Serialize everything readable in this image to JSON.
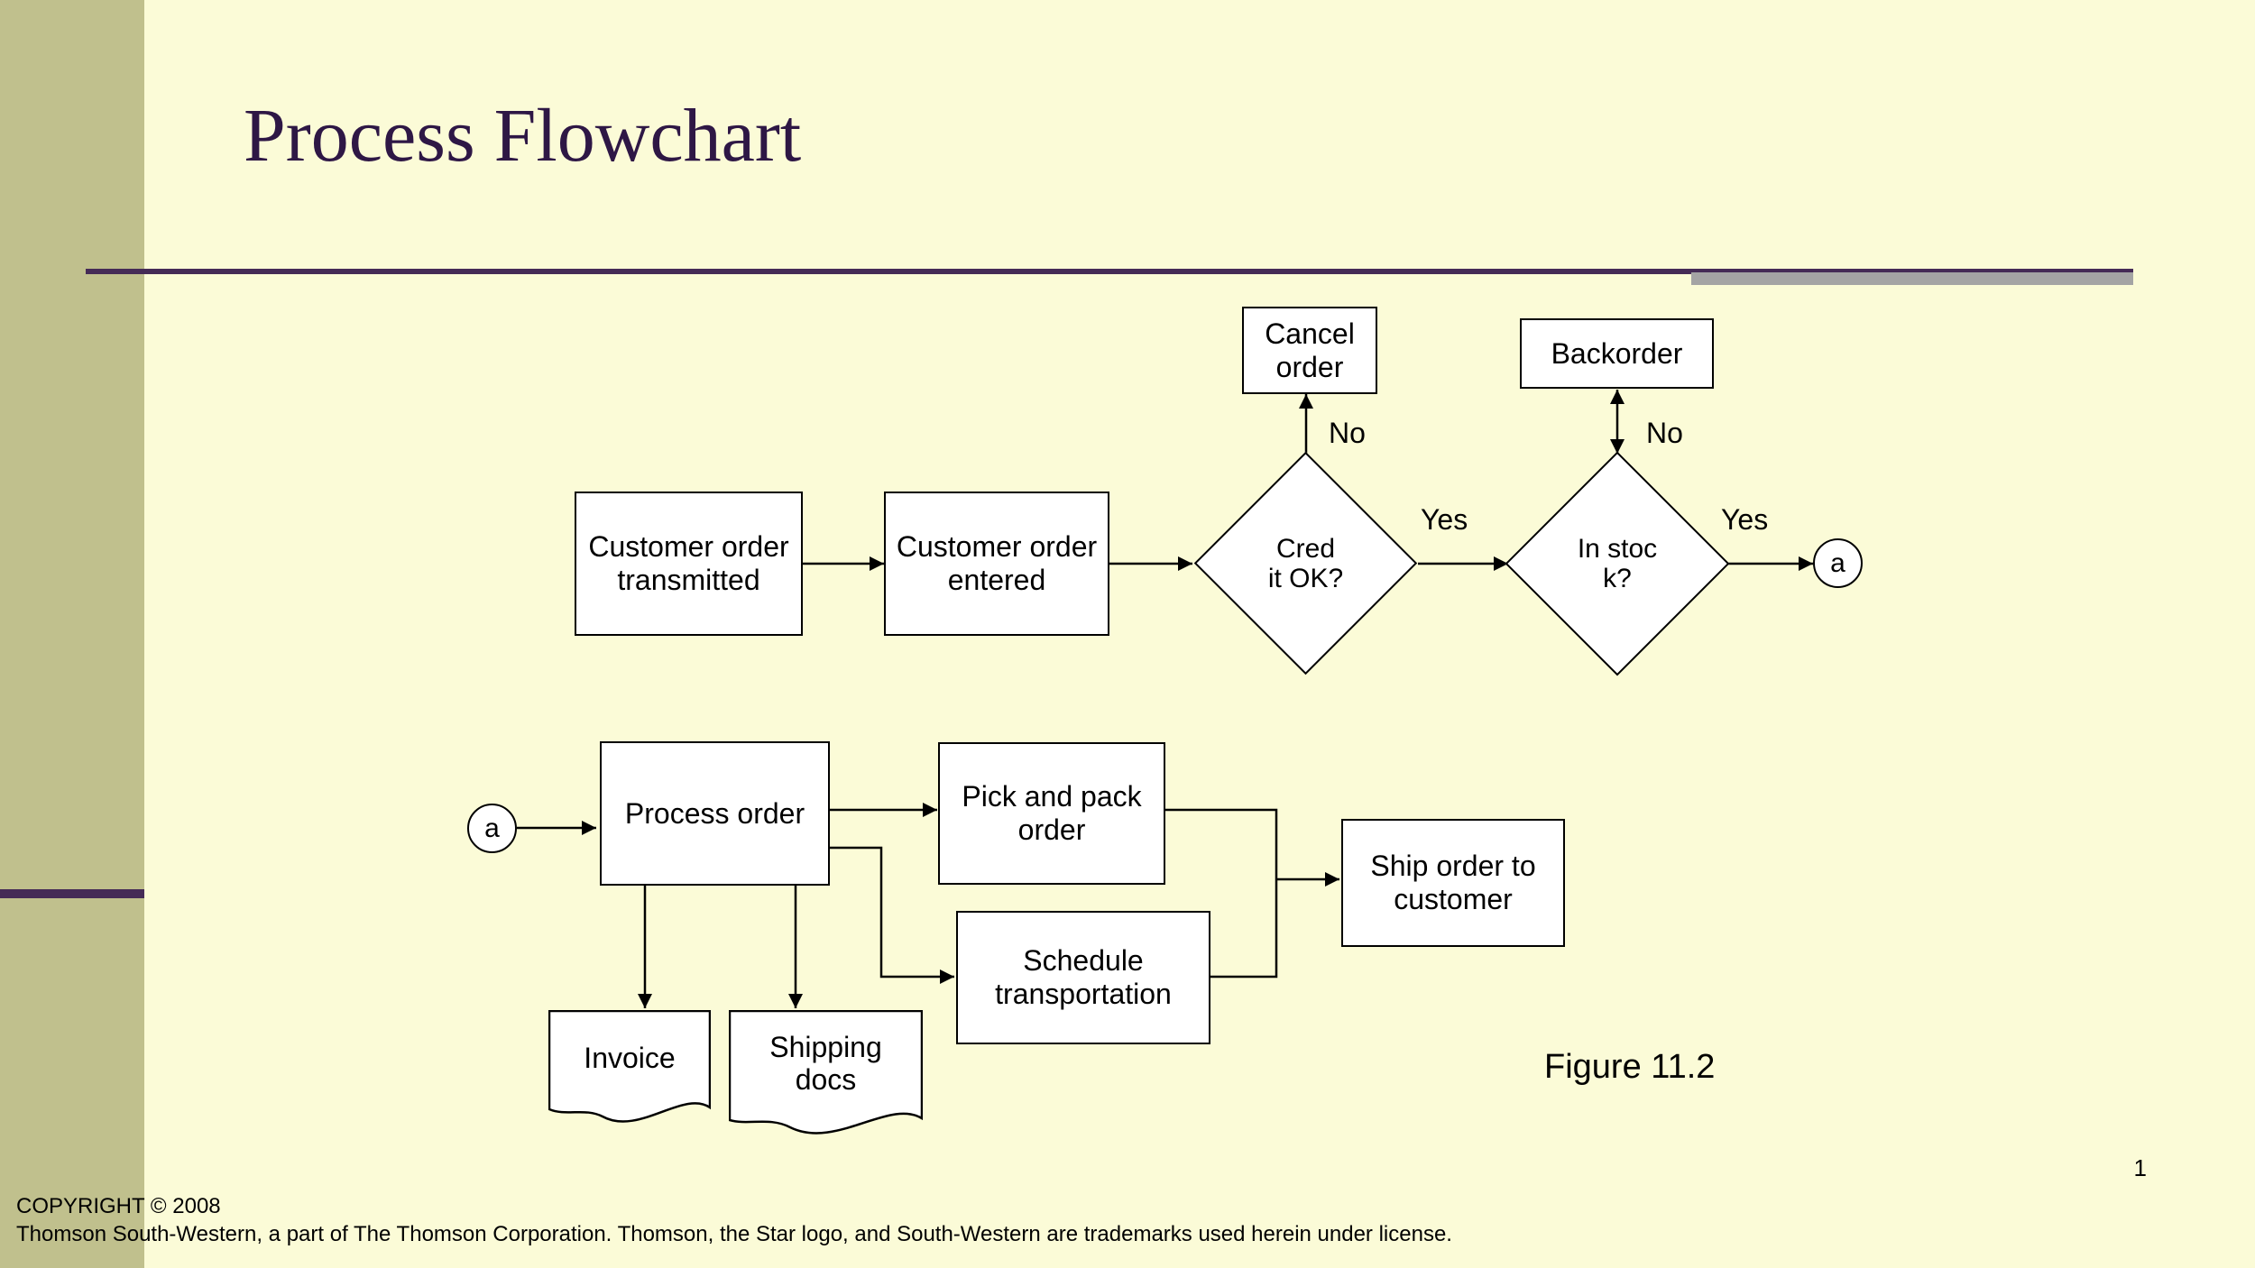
{
  "title": "Process Flowchart",
  "figure": "Figure 11.2",
  "page_number": "1",
  "copyright_line1": "COPYRIGHT © 2008",
  "copyright_line2": "Thomson South-Western, a part of The Thomson Corporation. Thomson, the Star logo, and South-Western are trademarks used herein under license.",
  "labels": {
    "no1": "No",
    "yes1": "Yes",
    "no2": "No",
    "yes2": "Yes"
  },
  "nodes": {
    "transmitted": "Customer order transmitted",
    "entered": "Customer order entered",
    "credit": "Cred\nit OK?",
    "cancel": "Cancel order",
    "instock": "In stoc\nk?",
    "backorder": "Backorder",
    "conn_a1": "a",
    "conn_a2": "a",
    "process": "Process order",
    "pickpack": "Pick and pack order",
    "schedule": "Schedule transportation",
    "ship": "Ship order to customer",
    "invoice": "Invoice",
    "shippingdocs": "Shipping docs"
  }
}
